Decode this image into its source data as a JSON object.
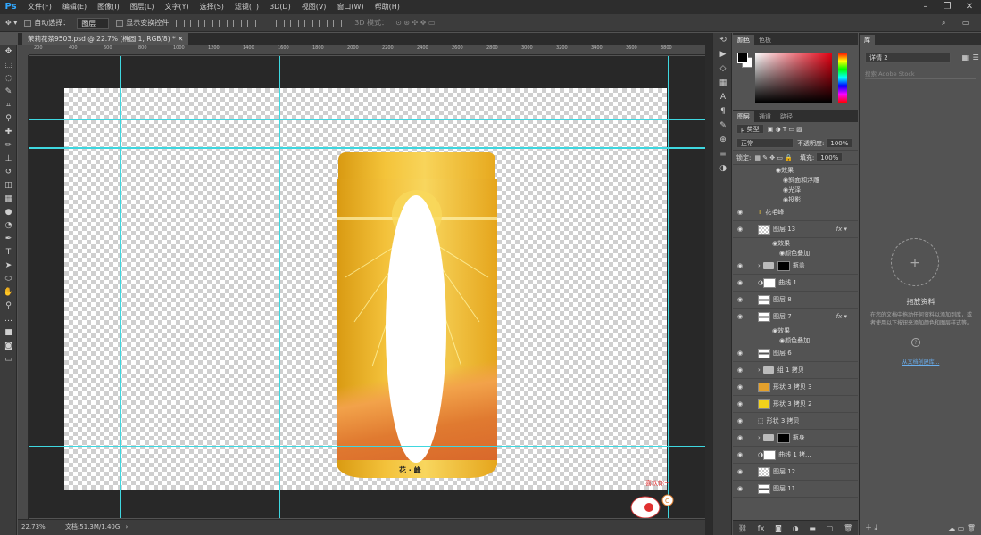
{
  "app": {
    "logo": "Ps"
  },
  "menu": [
    "文件(F)",
    "编辑(E)",
    "图像(I)",
    "图层(L)",
    "文字(Y)",
    "选择(S)",
    "滤镜(T)",
    "3D(D)",
    "视图(V)",
    "窗口(W)",
    "帮助(H)"
  ],
  "options": {
    "auto_select_label": "自动选择：",
    "auto_select_value": "图层",
    "show_transform_label": "显示变换控件",
    "mode_3d_label": "3D 模式："
  },
  "document": {
    "tab_title": "茉莉花茶9503.psd @ 22.7% (椭圆 1, RGB/8) *",
    "can_text": "花 · 峰"
  },
  "ruler": {
    "ticks": [
      "200",
      "400",
      "600",
      "800",
      "1000",
      "1200",
      "1400",
      "1600",
      "1800",
      "2000",
      "2200",
      "2400",
      "2600",
      "2800",
      "3000",
      "3200",
      "3400",
      "3600",
      "3800"
    ]
  },
  "mascot": {
    "text": "喜欢你~"
  },
  "status": {
    "zoom": "22.73%",
    "doc": "文档:51.3M/1.40G"
  },
  "color_panel": {
    "tabs": [
      "颜色",
      "色板"
    ],
    "accent": "#e60012"
  },
  "layers_panel": {
    "tabs": [
      "图层",
      "通道",
      "路径"
    ],
    "filter_label": "ρ 类型",
    "blend_mode": "正常",
    "opacity_label": "不透明度:",
    "opacity_value": "100%",
    "lock_label": "锁定:",
    "fill_label": "填充:",
    "fill_value": "100%",
    "effects_top": [
      {
        "label": "效果",
        "indent": 1
      },
      {
        "label": "斜面和浮雕",
        "indent": 2
      },
      {
        "label": "光泽",
        "indent": 2
      },
      {
        "label": "投影",
        "indent": 2
      }
    ],
    "layers": [
      {
        "name": "花毛峰",
        "thumb": "text",
        "fx": false
      },
      {
        "name": "图层 13",
        "thumb": "checker",
        "fx": true
      },
      {
        "name": "效果",
        "thumb": "effect1",
        "fx": false
      },
      {
        "name": "颜色叠加",
        "thumb": "effect2",
        "fx": false
      },
      {
        "name": "瓶盖",
        "thumb": "folder-black",
        "fx": false
      },
      {
        "name": "曲线 1",
        "thumb": "adjust-white",
        "fx": false
      },
      {
        "name": "图层 8",
        "thumb": "strip",
        "fx": false
      },
      {
        "name": "图层 7",
        "thumb": "strip",
        "fx": true
      },
      {
        "name": "效果",
        "thumb": "effect1",
        "fx": false
      },
      {
        "name": "颜色叠加",
        "thumb": "effect2",
        "fx": false
      },
      {
        "name": "图层 6",
        "thumb": "strip",
        "fx": false
      },
      {
        "name": "组 1 拷贝",
        "thumb": "folder",
        "fx": false
      },
      {
        "name": "形状 3 拷贝 3",
        "thumb": "orange",
        "fx": false
      },
      {
        "name": "形状 3 拷贝 2",
        "thumb": "yellow",
        "fx": false
      },
      {
        "name": "形状 3 拷贝",
        "thumb": "shape",
        "fx": false
      },
      {
        "name": "瓶身",
        "thumb": "folder-black",
        "fx": false
      },
      {
        "name": "曲线 1 拷...",
        "thumb": "adjust-white",
        "fx": false
      },
      {
        "name": "图层 12",
        "thumb": "checker",
        "fx": false
      },
      {
        "name": "图层 11",
        "thumb": "strip",
        "fx": false
      }
    ]
  },
  "library_panel": {
    "tab": "库",
    "library_select": "详情 2",
    "search_placeholder": "搜索 Adobe Stock",
    "empty_title": "拖放资料",
    "empty_desc": "在您的文档中拖动任何资料以添加到库，或者使用以下按钮来添加颜色和图层样式等。",
    "link": "从文档创建库..."
  }
}
